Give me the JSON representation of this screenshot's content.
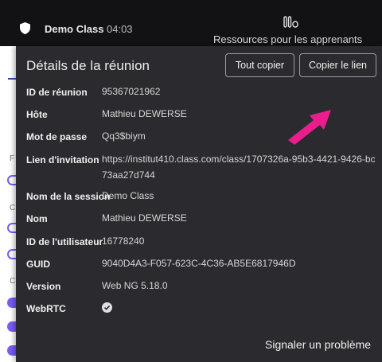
{
  "header": {
    "class_name": "Demo Class",
    "timer": "04:03",
    "resources_label": "Ressources pour les apprenants"
  },
  "panel": {
    "title": "Détails de la réunion",
    "copy_all_label": "Tout copier",
    "copy_link_label": "Copier le lien",
    "report_label": "Signaler un problème",
    "arrow_color": "#e91e8c",
    "fields": {
      "meeting_id": {
        "label": "ID de réunion",
        "value": "95367021962"
      },
      "host": {
        "label": "Hôte",
        "value": "Mathieu DEWERSE"
      },
      "password": {
        "label": "Mot de passe",
        "value": "Qq3$biym"
      },
      "invite": {
        "label": "Lien d'invitation",
        "value": "https://institut410.class.com/class/1707326a-95b3-4421-9426-bc73aa27d744"
      },
      "session_name": {
        "label": "Nom de la session",
        "value": "Demo Class"
      },
      "name": {
        "label": "Nom",
        "value": "Mathieu DEWERSE"
      },
      "user_id": {
        "label": "ID de l'utilisateur",
        "value": "16778240"
      },
      "guid": {
        "label": "GUID",
        "value": "9040D4A3-F057-623C-4C36-AB5E6817946D"
      },
      "version": {
        "label": "Version",
        "value": "Web NG 5.18.0"
      },
      "webrtc": {
        "label": "WebRTC",
        "value_icon": "check-circle-icon"
      }
    }
  },
  "background": {
    "letters": [
      "F",
      "C",
      "C"
    ]
  }
}
